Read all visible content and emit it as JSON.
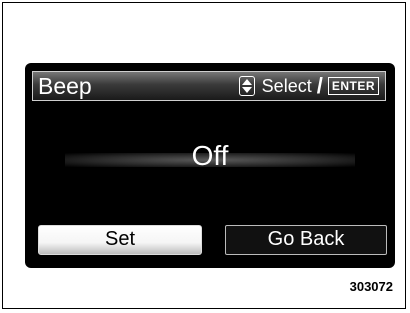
{
  "screen": {
    "title": "Beep",
    "hint": {
      "icon": "up-down-arrows-icon",
      "select_label": "Select",
      "separator": "/",
      "enter_label": "ENTER"
    },
    "current_value": "Off",
    "buttons": {
      "set_label": "Set",
      "go_back_label": "Go Back"
    }
  },
  "figure_code": "303072",
  "colors": {
    "screen_background": "#000000",
    "selected_button": "#ffffff",
    "text": "#ffffff"
  }
}
